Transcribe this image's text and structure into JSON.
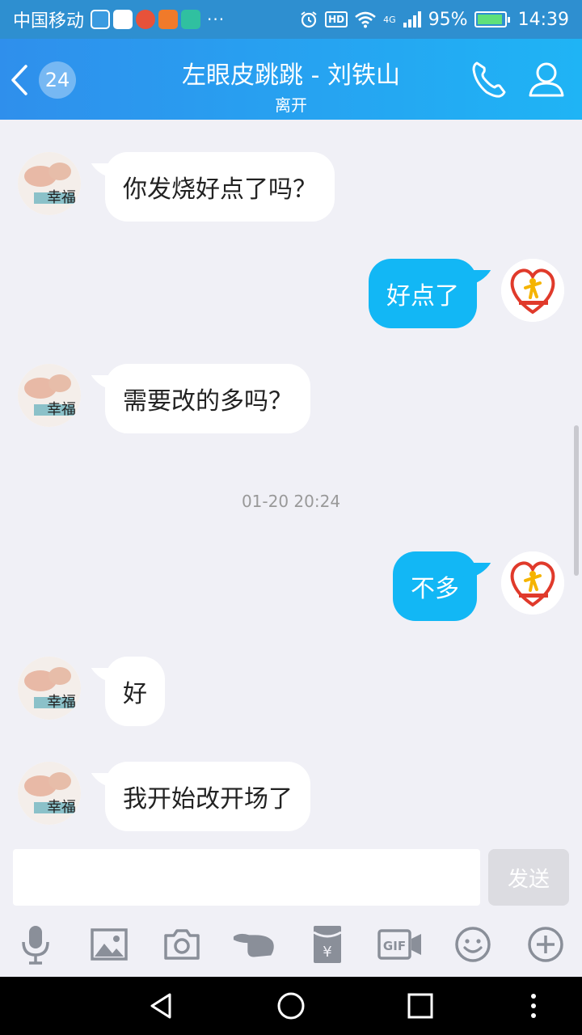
{
  "status_bar": {
    "carrier": "中国移动",
    "app_icons": [
      "video-app-icon",
      "photo-app-icon",
      "music-app-icon",
      "media-app-icon",
      "play-app-icon"
    ],
    "more": "···",
    "hd": "HD",
    "network": "4G",
    "battery": "95%",
    "battery_level": 0.95,
    "time": "14:39"
  },
  "header": {
    "back_count": "24",
    "title": "左眼皮跳跳 - 刘铁山",
    "status": "离开"
  },
  "messages": [
    {
      "side": "in",
      "text": "你发烧好点了吗？"
    },
    {
      "side": "out",
      "text": "好点了"
    },
    {
      "side": "in",
      "text": "需要改的多吗？"
    },
    {
      "timestamp": "01-20 20:24"
    },
    {
      "side": "out",
      "text": "不多"
    },
    {
      "side": "in",
      "text": "好"
    },
    {
      "side": "in",
      "text": "我开始改开场了"
    }
  ],
  "input": {
    "placeholder": "",
    "send_label": "发送"
  },
  "toolbar": [
    "microphone-icon",
    "image-icon",
    "camera-icon",
    "poke-hand-icon",
    "red-packet-icon",
    "gif-icon",
    "emoji-icon",
    "plus-icon"
  ],
  "colors": {
    "header_start": "#2f8fec",
    "header_end": "#1fb4f5",
    "outgoing_bubble": "#12b7f5",
    "incoming_bubble": "#ffffff",
    "background": "#f0f0f6"
  }
}
